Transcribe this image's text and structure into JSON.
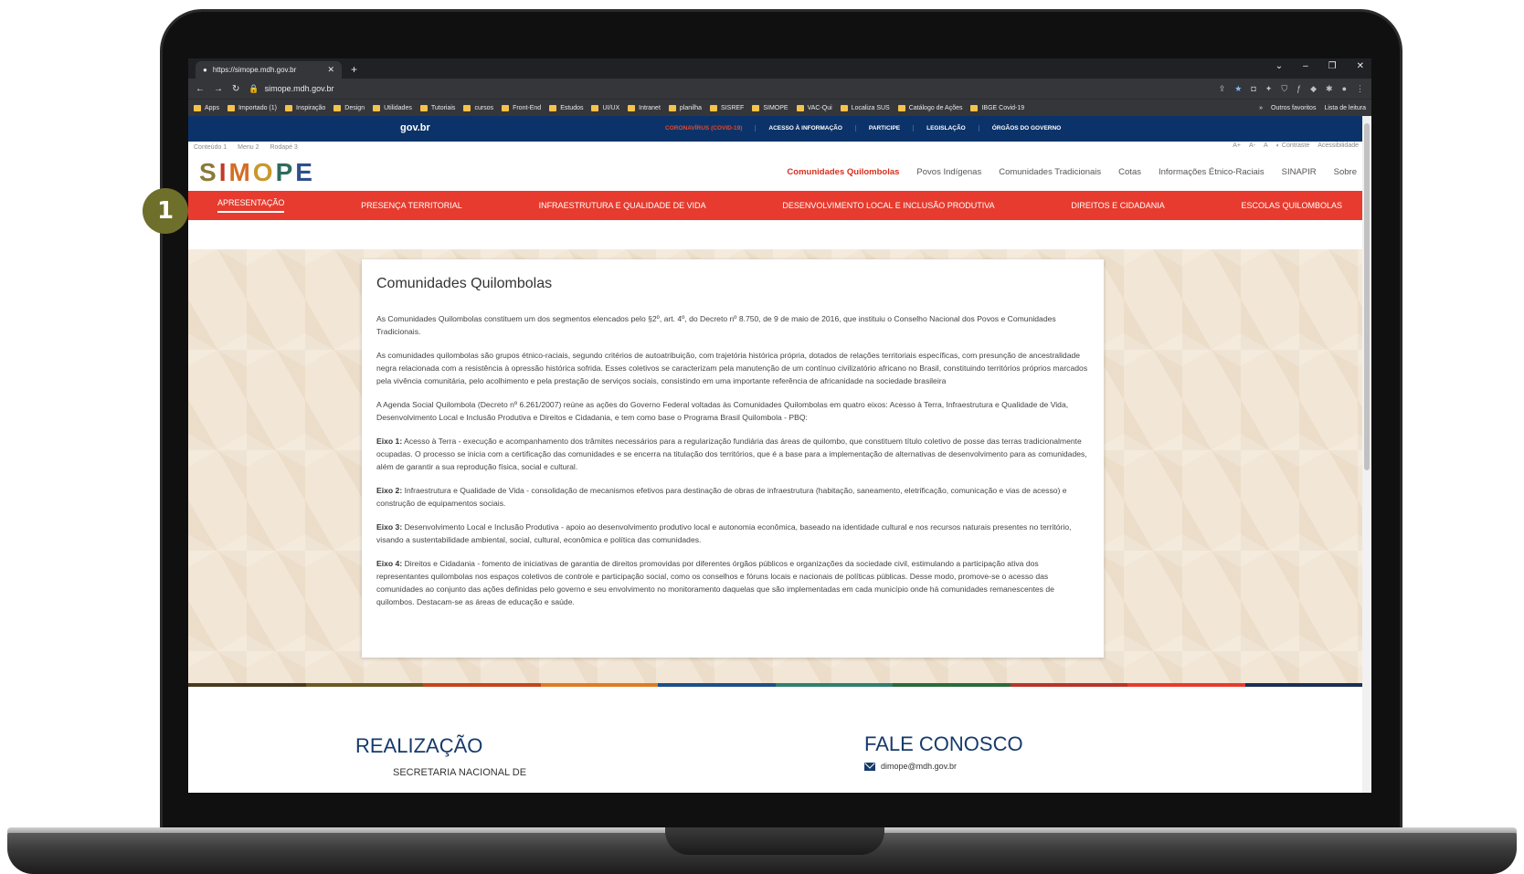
{
  "browser": {
    "tab_title": "https://simope.mdh.gov.br",
    "url": "simope.mdh.gov.br",
    "bookmarks": [
      "Apps",
      "Importado (1)",
      "Inspiração",
      "Design",
      "Utilidades",
      "Tutoriais",
      "cursos",
      "Front-End",
      "Estudos",
      "UI/UX",
      "Intranet",
      "planilha",
      "SISREF",
      "SIMOPE",
      "VAC-Qui",
      "Localiza SUS",
      "Catálogo de Ações",
      "IBGE Covid-19"
    ],
    "bookmarks_right": [
      "»",
      "Outros favoritos",
      "Lista de leitura"
    ]
  },
  "govbar": {
    "logo": "gov.br",
    "links": [
      "CORONAVÍRUS (COVID-19)",
      "ACESSO À INFORMAÇÃO",
      "PARTICIPE",
      "LEGISLAÇÃO",
      "ÓRGÃOS DO GOVERNO"
    ]
  },
  "access": {
    "left": [
      "Conteúdo 1",
      "Menu 2",
      "Rodapé 3"
    ],
    "right": [
      "A+",
      "A-",
      "A",
      "Contraste",
      "Acessibilidade"
    ]
  },
  "site": {
    "logo": [
      "S",
      "I",
      "M",
      "O",
      "P",
      "E"
    ],
    "nav": [
      "Comunidades Quilombolas",
      "Povos Indígenas",
      "Comunidades Tradicionais",
      "Cotas",
      "Informações Étnico-Raciais",
      "SINAPIR",
      "Sobre"
    ],
    "subnav": [
      "APRESENTAÇÃO",
      "PRESENÇA TERRITORIAL",
      "INFRAESTRUTURA E QUALIDADE DE VIDA",
      "DESENVOLVIMENTO LOCAL E INCLUSÃO PRODUTIVA",
      "DIREITOS E CIDADANIA",
      "ESCOLAS QUILOMBOLAS"
    ]
  },
  "content": {
    "title": "Comunidades Quilombolas",
    "p1": "As Comunidades Quilombolas constituem um dos segmentos elencados pelo §2º, art. 4º, do Decreto nº 8.750, de 9 de maio de 2016, que instituiu o Conselho Nacional dos Povos e Comunidades Tradicionais.",
    "p2": "As comunidades quilombolas são grupos étnico-raciais, segundo critérios de autoatribuição, com trajetória histórica própria, dotados de relações territoriais específicas, com presunção de ancestralidade negra relacionada com a resistência à opressão histórica sofrida. Esses coletivos se caracterizam pela manutenção de um contínuo civilizatório africano no Brasil, constituindo territórios próprios marcados pela vivência comunitária, pelo acolhimento e pela prestação de serviços sociais, consistindo em uma importante referência de africanidade na sociedade brasileira",
    "p3": "A Agenda Social Quilombola (Decreto nº 6.261/2007) reúne as ações do Governo Federal voltadas às Comunidades Quilombolas em quatro eixos: Acesso à Terra, Infraestrutura e Qualidade de Vida, Desenvolvimento Local e Inclusão Produtiva e Direitos e Cidadania, e tem como base o Programa Brasil Quilombola - PBQ:",
    "e1_label": "Eixo 1:",
    "e1": " Acesso à Terra - execução e acompanhamento dos trâmites necessários para a regularização fundiária das áreas de quilombo, que constituem título coletivo de posse das terras tradicionalmente ocupadas. O processo se inicia com a certificação das comunidades e se encerra na titulação dos territórios, que é a base para a implementação de alternativas de desenvolvimento para as comunidades, além de garantir a sua reprodução física, social e cultural.",
    "e2_label": "Eixo 2:",
    "e2": " Infraestrutura e Qualidade de Vida - consolidação de mecanismos efetivos para destinação de obras de infraestrutura (habitação, saneamento, eletrificação, comunicação e vias de acesso) e construção de equipamentos sociais.",
    "e3_label": "Eixo 3:",
    "e3": " Desenvolvimento Local e Inclusão Produtiva - apoio ao desenvolvimento produtivo local e autonomia econômica, baseado na identidade cultural e nos recursos naturais presentes no território, visando a sustentabilidade ambiental, social, cultural, econômica e política das comunidades.",
    "e4_label": "Eixo 4:",
    "e4": " Direitos e Cidadania - fomento de iniciativas de garantia de direitos promovidas por diferentes órgãos públicos e organizações da sociedade civil, estimulando a participação ativa dos representantes quilombolas nos espaços coletivos de controle e participação social, como os conselhos e fóruns locais e nacionais de políticas públicas. Desse modo, promove-se o acesso das comunidades ao conjunto das ações definidas pelo governo e seu envolvimento no monitoramento daquelas que são implementadas em cada município onde há comunidades remanescentes de quilombos. Destacam-se as áreas de educação e saúde."
  },
  "footer": {
    "realizacao": "REALIZAÇÃO",
    "secretaria": "SECRETARIA NACIONAL DE",
    "fale": "FALE CONOSCO",
    "email": "dimope@mdh.gov.br"
  },
  "badge": "1",
  "colors": {
    "govbar": "#0c3369",
    "rednav": "#e63b2e",
    "badge": "#6f6f2c",
    "stripe": [
      "#4b3a1f",
      "#6b5a24",
      "#c4451c",
      "#e07a23",
      "#1d4f8c",
      "#2f7f6e",
      "#2a6b3a",
      "#b8352a",
      "#e63b2e",
      "#1a2f55"
    ]
  }
}
